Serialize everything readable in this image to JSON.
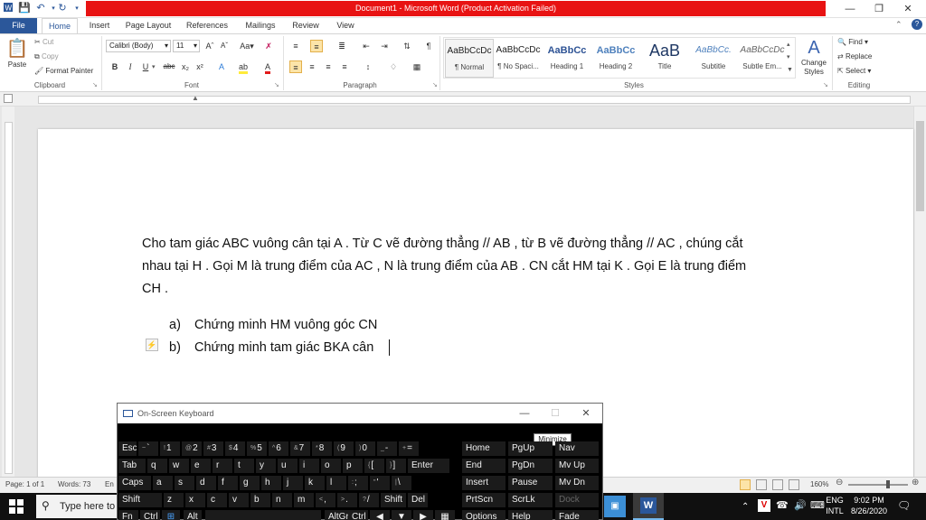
{
  "window": {
    "title": "Document1 - Microsoft Word (Product Activation Failed)"
  },
  "quick_access": {
    "word_icon": "word-icon",
    "save": "save-icon",
    "undo": "undo-icon",
    "redo": "redo-icon",
    "customize": "customize-icon"
  },
  "tabs": [
    {
      "label": "File"
    },
    {
      "label": "Home"
    },
    {
      "label": "Insert"
    },
    {
      "label": "Page Layout"
    },
    {
      "label": "References"
    },
    {
      "label": "Mailings"
    },
    {
      "label": "Review"
    },
    {
      "label": "View"
    }
  ],
  "clipboard": {
    "paste": "Paste",
    "cut": "Cut",
    "copy": "Copy",
    "format_painter": "Format Painter",
    "label": "Clipboard"
  },
  "font": {
    "name": "Calibri (Body)",
    "size": "11",
    "label": "Font",
    "bold": "B",
    "italic": "I",
    "underline": "U",
    "strike": "abc",
    "sub": "x₂",
    "sup": "x²"
  },
  "paragraph": {
    "label": "Paragraph"
  },
  "styles": {
    "label": "Styles",
    "items": [
      {
        "preview": "AaBbCcDc",
        "name": "¶ Normal"
      },
      {
        "preview": "AaBbCcDc",
        "name": "¶ No Spaci..."
      },
      {
        "preview": "AaBbCc",
        "name": "Heading 1"
      },
      {
        "preview": "AaBbCc",
        "name": "Heading 2"
      },
      {
        "preview": "AaB",
        "name": "Title"
      },
      {
        "preview": "AaBbCc.",
        "name": "Subtitle"
      },
      {
        "preview": "AaBbCcDc",
        "name": "Subtle Em..."
      }
    ],
    "change_styles": "Change Styles"
  },
  "editing": {
    "find": "Find",
    "replace": "Replace",
    "select": "Select",
    "label": "Editing"
  },
  "document": {
    "para1_line1": "Cho tam giác ABC vuông cân tại A . Từ C vẽ đường thẳng // AB , từ B vẽ đường thẳng // AC , chúng cắt",
    "para1_line2": "nhau tại H . Gọi M là trung điểm của AC , N là trung điểm của AB . CN cắt HM tại K . Gọi E là trung điểm",
    "para1_line3": "CH .",
    "list": [
      {
        "marker": "a)",
        "text": "Chứng minh HM vuông góc CN"
      },
      {
        "marker": "b)",
        "text": "Chứng minh tam giác BKA cân"
      }
    ]
  },
  "status": {
    "page": "Page: 1 of 1",
    "words": "Words: 73",
    "lang": "En",
    "zoom": "160%"
  },
  "osk": {
    "title": "On-Screen Keyboard",
    "tooltip": "Minimize",
    "rows": [
      [
        "Esc",
        "~ `",
        "! 1",
        "@ 2",
        "# 3",
        "$ 4",
        "% 5",
        "^ 6",
        "& 7",
        "* 8",
        "( 9",
        ") 0",
        "_ -",
        "+ ="
      ],
      [
        "Tab",
        "q",
        "w",
        "e",
        "r",
        "t",
        "y",
        "u",
        "i",
        "o",
        "p",
        "{ [",
        "} ]",
        "Enter"
      ],
      [
        "Caps",
        "a",
        "s",
        "d",
        "f",
        "g",
        "h",
        "j",
        "k",
        "l",
        ": ;",
        "\" '",
        "| \\"
      ],
      [
        "Shift",
        "z",
        "x",
        "c",
        "v",
        "b",
        "n",
        "m",
        "< ,",
        "> .",
        "? /",
        "Shift",
        "Del"
      ],
      [
        "Fn",
        "Ctrl",
        "Alt",
        "AltGr",
        "Ctrl"
      ]
    ],
    "nav": [
      [
        "Home",
        "PgUp",
        "Nav"
      ],
      [
        "End",
        "PgDn",
        "Mv Up"
      ],
      [
        "Insert",
        "Pause",
        "Mv Dn"
      ],
      [
        "PrtScn",
        "ScrLk",
        "Dock"
      ],
      [
        "Options",
        "Help",
        "Fade"
      ]
    ]
  },
  "taskbar": {
    "search_placeholder": "Type here to",
    "lang_line1": "ENG",
    "lang_line2": "INTL",
    "time": "9:02 PM",
    "date": "8/26/2020"
  }
}
